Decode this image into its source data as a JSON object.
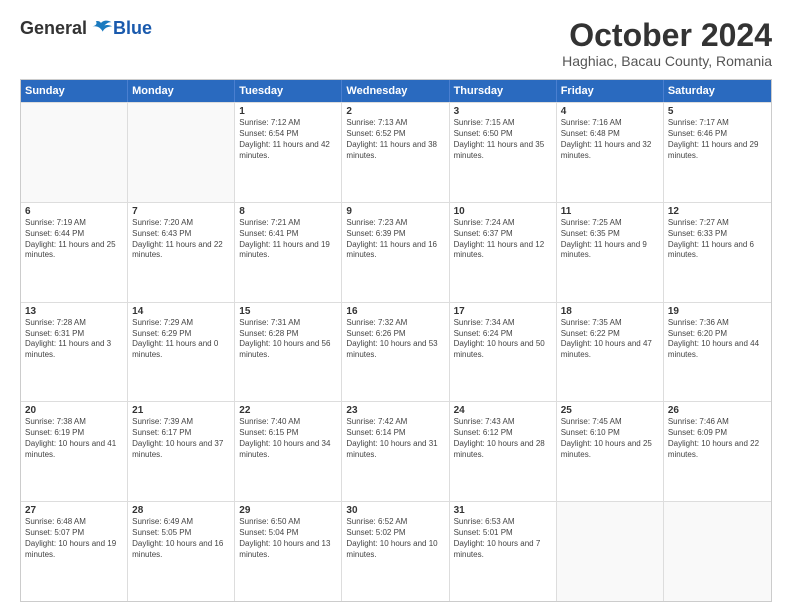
{
  "header": {
    "logo_general": "General",
    "logo_blue": "Blue",
    "month_title": "October 2024",
    "location": "Haghiac, Bacau County, Romania"
  },
  "calendar": {
    "days_of_week": [
      "Sunday",
      "Monday",
      "Tuesday",
      "Wednesday",
      "Thursday",
      "Friday",
      "Saturday"
    ],
    "rows": [
      [
        {
          "day": "",
          "empty": true
        },
        {
          "day": "",
          "empty": true
        },
        {
          "day": "1",
          "sunrise": "Sunrise: 7:12 AM",
          "sunset": "Sunset: 6:54 PM",
          "daylight": "Daylight: 11 hours and 42 minutes."
        },
        {
          "day": "2",
          "sunrise": "Sunrise: 7:13 AM",
          "sunset": "Sunset: 6:52 PM",
          "daylight": "Daylight: 11 hours and 38 minutes."
        },
        {
          "day": "3",
          "sunrise": "Sunrise: 7:15 AM",
          "sunset": "Sunset: 6:50 PM",
          "daylight": "Daylight: 11 hours and 35 minutes."
        },
        {
          "day": "4",
          "sunrise": "Sunrise: 7:16 AM",
          "sunset": "Sunset: 6:48 PM",
          "daylight": "Daylight: 11 hours and 32 minutes."
        },
        {
          "day": "5",
          "sunrise": "Sunrise: 7:17 AM",
          "sunset": "Sunset: 6:46 PM",
          "daylight": "Daylight: 11 hours and 29 minutes."
        }
      ],
      [
        {
          "day": "6",
          "sunrise": "Sunrise: 7:19 AM",
          "sunset": "Sunset: 6:44 PM",
          "daylight": "Daylight: 11 hours and 25 minutes."
        },
        {
          "day": "7",
          "sunrise": "Sunrise: 7:20 AM",
          "sunset": "Sunset: 6:43 PM",
          "daylight": "Daylight: 11 hours and 22 minutes."
        },
        {
          "day": "8",
          "sunrise": "Sunrise: 7:21 AM",
          "sunset": "Sunset: 6:41 PM",
          "daylight": "Daylight: 11 hours and 19 minutes."
        },
        {
          "day": "9",
          "sunrise": "Sunrise: 7:23 AM",
          "sunset": "Sunset: 6:39 PM",
          "daylight": "Daylight: 11 hours and 16 minutes."
        },
        {
          "day": "10",
          "sunrise": "Sunrise: 7:24 AM",
          "sunset": "Sunset: 6:37 PM",
          "daylight": "Daylight: 11 hours and 12 minutes."
        },
        {
          "day": "11",
          "sunrise": "Sunrise: 7:25 AM",
          "sunset": "Sunset: 6:35 PM",
          "daylight": "Daylight: 11 hours and 9 minutes."
        },
        {
          "day": "12",
          "sunrise": "Sunrise: 7:27 AM",
          "sunset": "Sunset: 6:33 PM",
          "daylight": "Daylight: 11 hours and 6 minutes."
        }
      ],
      [
        {
          "day": "13",
          "sunrise": "Sunrise: 7:28 AM",
          "sunset": "Sunset: 6:31 PM",
          "daylight": "Daylight: 11 hours and 3 minutes."
        },
        {
          "day": "14",
          "sunrise": "Sunrise: 7:29 AM",
          "sunset": "Sunset: 6:29 PM",
          "daylight": "Daylight: 11 hours and 0 minutes."
        },
        {
          "day": "15",
          "sunrise": "Sunrise: 7:31 AM",
          "sunset": "Sunset: 6:28 PM",
          "daylight": "Daylight: 10 hours and 56 minutes."
        },
        {
          "day": "16",
          "sunrise": "Sunrise: 7:32 AM",
          "sunset": "Sunset: 6:26 PM",
          "daylight": "Daylight: 10 hours and 53 minutes."
        },
        {
          "day": "17",
          "sunrise": "Sunrise: 7:34 AM",
          "sunset": "Sunset: 6:24 PM",
          "daylight": "Daylight: 10 hours and 50 minutes."
        },
        {
          "day": "18",
          "sunrise": "Sunrise: 7:35 AM",
          "sunset": "Sunset: 6:22 PM",
          "daylight": "Daylight: 10 hours and 47 minutes."
        },
        {
          "day": "19",
          "sunrise": "Sunrise: 7:36 AM",
          "sunset": "Sunset: 6:20 PM",
          "daylight": "Daylight: 10 hours and 44 minutes."
        }
      ],
      [
        {
          "day": "20",
          "sunrise": "Sunrise: 7:38 AM",
          "sunset": "Sunset: 6:19 PM",
          "daylight": "Daylight: 10 hours and 41 minutes."
        },
        {
          "day": "21",
          "sunrise": "Sunrise: 7:39 AM",
          "sunset": "Sunset: 6:17 PM",
          "daylight": "Daylight: 10 hours and 37 minutes."
        },
        {
          "day": "22",
          "sunrise": "Sunrise: 7:40 AM",
          "sunset": "Sunset: 6:15 PM",
          "daylight": "Daylight: 10 hours and 34 minutes."
        },
        {
          "day": "23",
          "sunrise": "Sunrise: 7:42 AM",
          "sunset": "Sunset: 6:14 PM",
          "daylight": "Daylight: 10 hours and 31 minutes."
        },
        {
          "day": "24",
          "sunrise": "Sunrise: 7:43 AM",
          "sunset": "Sunset: 6:12 PM",
          "daylight": "Daylight: 10 hours and 28 minutes."
        },
        {
          "day": "25",
          "sunrise": "Sunrise: 7:45 AM",
          "sunset": "Sunset: 6:10 PM",
          "daylight": "Daylight: 10 hours and 25 minutes."
        },
        {
          "day": "26",
          "sunrise": "Sunrise: 7:46 AM",
          "sunset": "Sunset: 6:09 PM",
          "daylight": "Daylight: 10 hours and 22 minutes."
        }
      ],
      [
        {
          "day": "27",
          "sunrise": "Sunrise: 6:48 AM",
          "sunset": "Sunset: 5:07 PM",
          "daylight": "Daylight: 10 hours and 19 minutes."
        },
        {
          "day": "28",
          "sunrise": "Sunrise: 6:49 AM",
          "sunset": "Sunset: 5:05 PM",
          "daylight": "Daylight: 10 hours and 16 minutes."
        },
        {
          "day": "29",
          "sunrise": "Sunrise: 6:50 AM",
          "sunset": "Sunset: 5:04 PM",
          "daylight": "Daylight: 10 hours and 13 minutes."
        },
        {
          "day": "30",
          "sunrise": "Sunrise: 6:52 AM",
          "sunset": "Sunset: 5:02 PM",
          "daylight": "Daylight: 10 hours and 10 minutes."
        },
        {
          "day": "31",
          "sunrise": "Sunrise: 6:53 AM",
          "sunset": "Sunset: 5:01 PM",
          "daylight": "Daylight: 10 hours and 7 minutes."
        },
        {
          "day": "",
          "empty": true
        },
        {
          "day": "",
          "empty": true
        }
      ]
    ]
  }
}
